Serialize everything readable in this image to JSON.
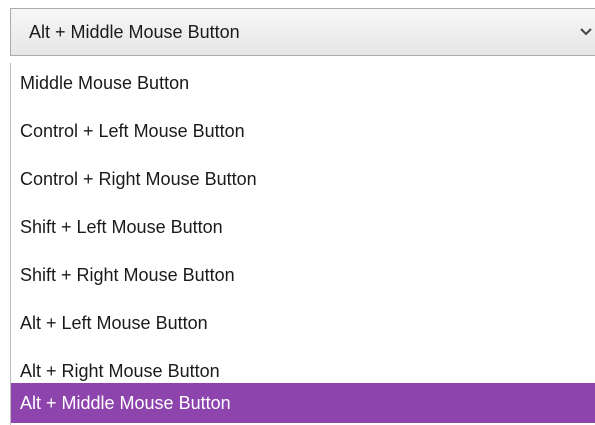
{
  "combobox": {
    "selected_value": "Alt + Middle Mouse Button",
    "chevron_icon": "chevron-down-icon"
  },
  "dropdown": {
    "options": [
      "Middle Mouse Button",
      "Control + Left Mouse Button",
      "Control + Right Mouse Button",
      "Shift + Left Mouse Button",
      "Shift + Right Mouse Button",
      "Alt + Left Mouse Button",
      "Alt + Right Mouse Button",
      "Alt + Middle Mouse Button"
    ],
    "highlighted_option": "Alt + Middle Mouse Button"
  },
  "colors": {
    "highlight_background": "#8e44ad",
    "highlight_text": "#ffffff"
  }
}
